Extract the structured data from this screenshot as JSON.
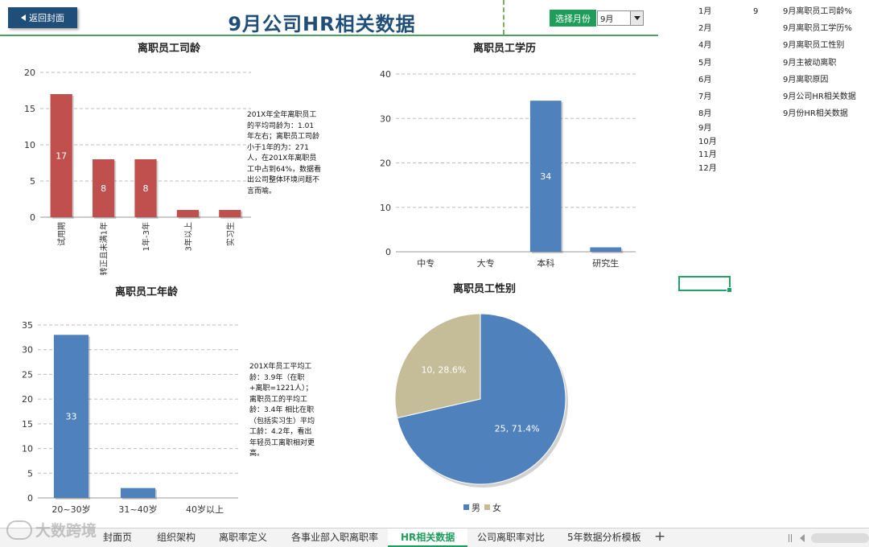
{
  "header": {
    "back_label": "返回封面",
    "title": "9月公司HR相关数据",
    "month_button": "选择月份",
    "month_value": "9月"
  },
  "side_list": [
    {
      "month": "1月",
      "value": "9",
      "name": "9月离职员工司龄%"
    },
    {
      "month": "2月",
      "value": "",
      "name": "9月离职员工学历%"
    },
    {
      "month": "4月",
      "value": "",
      "name": "9月离职员工性别"
    },
    {
      "month": "5月",
      "value": "",
      "name": "9月主被动离职"
    },
    {
      "month": "6月",
      "value": "",
      "name": "9月离职原因"
    },
    {
      "month": "7月",
      "value": "",
      "name": "9月公司HR相关数据"
    },
    {
      "month": "8月",
      "value": "",
      "name": "9月份HR相关数据"
    },
    {
      "month": "9月",
      "value": "",
      "name": ""
    },
    {
      "month": "10月",
      "value": "",
      "name": ""
    },
    {
      "month": "11月",
      "value": "",
      "name": ""
    },
    {
      "month": "12月",
      "value": "",
      "name": ""
    }
  ],
  "notes": {
    "tenure": "201X年全年离职员工的平均司龄为：1.01年左右；离职员工司龄小于1年的为：271人，在201X年离职员工中占到64%，数据看出公司整体环境问题不言而喻。",
    "age": "201X年员工平均工龄：3.9年（在职+离职=1221人）；离职员工的平均工龄：3.4年 相比在职（包括实习生）平均工龄：4.2年，看出年轻员工离职相对更高。"
  },
  "chart_data": [
    {
      "type": "bar",
      "title": "离职员工司龄",
      "categories": [
        "试用期",
        "转正且未满1年",
        "1年-3年",
        "3年以上",
        "实习生"
      ],
      "values": [
        17,
        8,
        8,
        1,
        1
      ],
      "ylim": [
        0,
        20
      ],
      "yticks": [
        0,
        5,
        10,
        15,
        20
      ],
      "color": "#c0504d",
      "grid": true,
      "legend": "none"
    },
    {
      "type": "bar",
      "title": "离职员工学历",
      "categories": [
        "中专",
        "大专",
        "本科",
        "研究生"
      ],
      "values": [
        0,
        0,
        34,
        1
      ],
      "ylim": [
        0,
        40
      ],
      "yticks": [
        0,
        10,
        20,
        30,
        40
      ],
      "color": "#4f81bd",
      "grid": true,
      "legend": "none"
    },
    {
      "type": "bar",
      "title": "离职员工年龄",
      "categories": [
        "20~30岁",
        "31~40岁",
        "40岁以上"
      ],
      "values": [
        33,
        2,
        0
      ],
      "ylim": [
        0,
        35
      ],
      "yticks": [
        0,
        5,
        10,
        15,
        20,
        25,
        30,
        35
      ],
      "color": "#4f81bd",
      "grid": true,
      "legend": "none"
    },
    {
      "type": "pie",
      "title": "离职员工性别",
      "slices": [
        {
          "label": "男",
          "value": 25,
          "percent": "71.4%",
          "color": "#4f81bd"
        },
        {
          "label": "女",
          "value": 10,
          "percent": "28.6%",
          "color": "#c4bd97"
        }
      ],
      "legend": "bottom"
    }
  ],
  "tabs": [
    {
      "label": "封面页",
      "active": false
    },
    {
      "label": "组织架构",
      "active": false
    },
    {
      "label": "离职率定义",
      "active": false
    },
    {
      "label": "各事业部入职离职率",
      "active": false
    },
    {
      "label": "HR相关数据",
      "active": true
    },
    {
      "label": "公司离职率对比",
      "active": false
    },
    {
      "label": "5年数据分析模板",
      "active": false
    }
  ],
  "watermark": "大数跨境"
}
